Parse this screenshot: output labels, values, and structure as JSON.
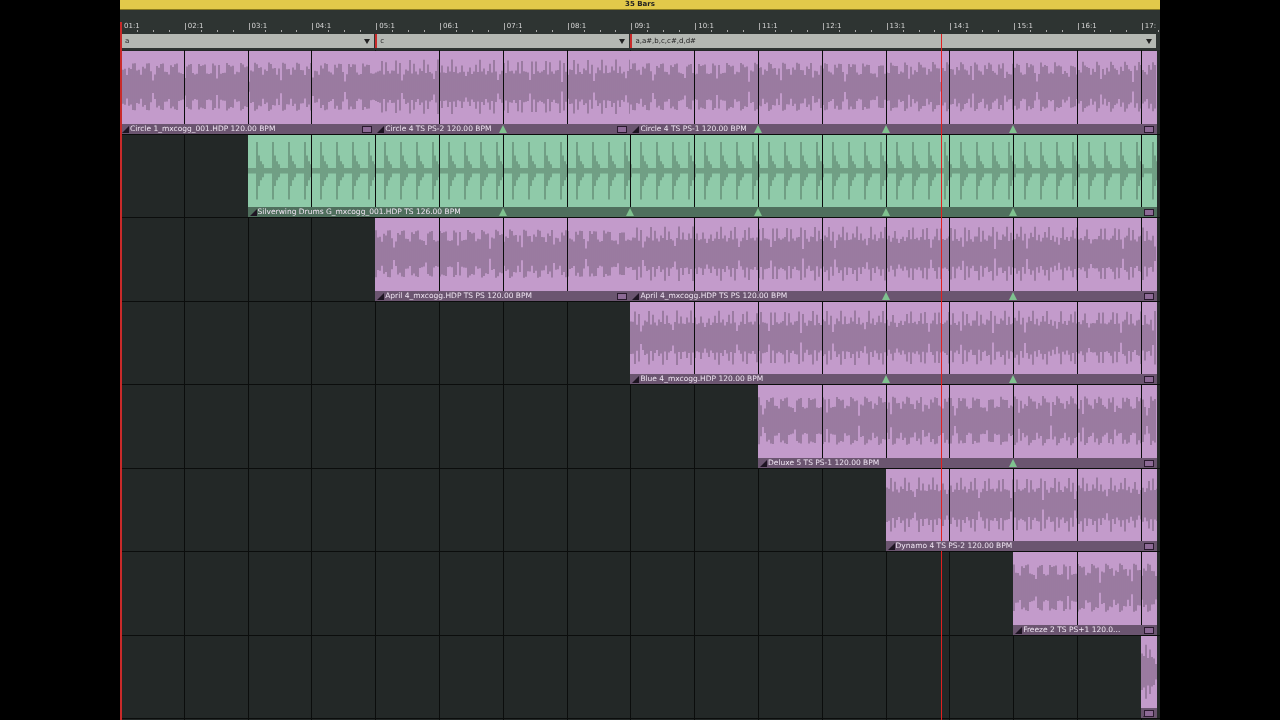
{
  "header": {
    "length": "35 Bars"
  },
  "ruler": {
    "labels": [
      "01:1",
      "02:1",
      "03:1",
      "04:1",
      "05:1",
      "06:1",
      "07:1",
      "08:1",
      "09:1",
      "10:1",
      "11:1",
      "12:1",
      "13:1",
      "14:1",
      "15:1",
      "16:1",
      "17:"
    ]
  },
  "chord_track": {
    "segments": [
      {
        "label": "a"
      },
      {
        "label": "c"
      },
      {
        "label": "a,a#,b,c,c#,d,d#"
      }
    ]
  },
  "tracks": [
    {
      "color": "#c39bcb",
      "clips": [
        {
          "kind": "audio",
          "label": "Circle 1_mxcogg_001.HDP  120.00 BPM"
        },
        {
          "kind": "audio",
          "label": "Circle 4  TS PS-2  120.00 BPM"
        },
        {
          "kind": "audio",
          "label": "Circle 4  TS PS-1  120.00 BPM"
        }
      ]
    },
    {
      "color": "#8fcaa9",
      "clips": [
        {
          "kind": "audio",
          "label": "Silverwing Drums G_mxcogg_001.HDP  TS  126.00 BPM"
        }
      ]
    },
    {
      "color": "#c39bcb",
      "clips": [
        {
          "kind": "audio",
          "label": "April 4_mxcogg.HDP  TS PS  120.00 BPM"
        },
        {
          "kind": "audio",
          "label": "April 4_mxcogg.HDP  TS PS  120.00 BPM"
        }
      ]
    },
    {
      "color": "#c39bcb",
      "clips": [
        {
          "kind": "audio",
          "label": "Blue 4_mxcogg.HDP  120.00 BPM"
        }
      ]
    },
    {
      "color": "#c39bcb",
      "clips": [
        {
          "kind": "audio",
          "label": "Deluxe 5  TS PS-1  120.00 BPM"
        }
      ]
    },
    {
      "color": "#c39bcb",
      "clips": [
        {
          "kind": "audio",
          "label": "Dynamo 4  TS PS-2  120.00 BPM"
        }
      ]
    },
    {
      "color": "#c39bcb",
      "clips": [
        {
          "kind": "audio",
          "label": "Freeze 2  TS PS+1  120.0..."
        }
      ]
    },
    {
      "color": "#c39bcb",
      "clips": [
        {
          "kind": "audio"
        }
      ]
    }
  ]
}
